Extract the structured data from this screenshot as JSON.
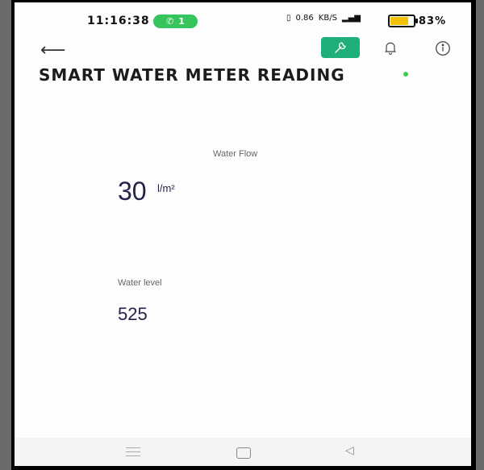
{
  "status_bar": {
    "time": "11:16:38",
    "call_pill": "1",
    "net_speed": "0.86",
    "net_unit": "KB/S",
    "battery_percent": "83%",
    "battery_level": 0.83
  },
  "header": {
    "title": "SMART WATER METER READING",
    "online_color": "#46c94e",
    "accent_color": "#1fb07a"
  },
  "readings": {
    "flow_label": "Water Flow",
    "flow_value": "30",
    "flow_unit": "l/m²",
    "level_label": "Water level",
    "level_value": "525"
  }
}
